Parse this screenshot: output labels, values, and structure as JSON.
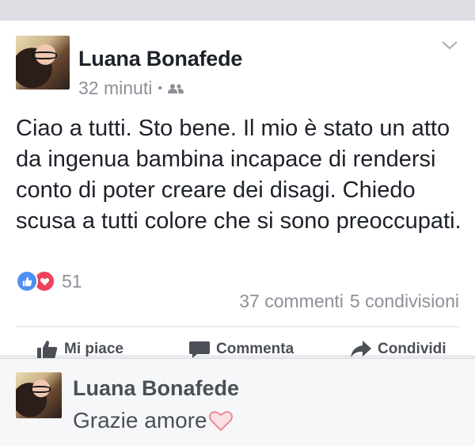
{
  "post": {
    "author": "Luana Bonafede",
    "time": "32 minuti",
    "separator": "•",
    "privacy_icon": "friends-icon",
    "text": "Ciao a tutti. Sto bene. Il mio è stato un atto da ingenua bambina incapace di rendersi conto di poter creare dei disagi. Chiedo scusa a tutti colore che si sono preoccupati.",
    "reactions": {
      "icons": [
        "like-icon",
        "love-icon"
      ],
      "count": "51"
    },
    "comments_count": "37 commenti",
    "shares_count": "5 condivisioni"
  },
  "actions": {
    "like_label": "Mi piace",
    "comment_label": "Commenta",
    "share_label": "Condividi"
  },
  "comment": {
    "author": "Luana Bonafede",
    "text": "Grazie amore",
    "emoji": "heart-icon"
  },
  "colors": {
    "like": "#4e8ff0",
    "love": "#f0415a",
    "muted": "#8c9097",
    "action": "#4b4f56",
    "heart_outline": "#e88b95"
  }
}
